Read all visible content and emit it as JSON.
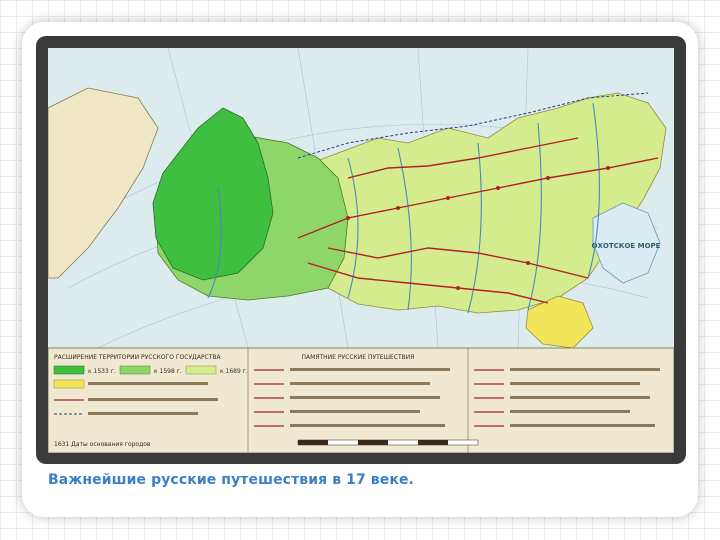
{
  "slide": {
    "caption": "Важнейшие русские путешествия в 17 веке."
  },
  "map": {
    "sea_labels": [
      "ОХОТСКОЕ МОРЕ"
    ],
    "legend": {
      "left_title": "РАСШИРЕНИЕ ТЕРРИТОРИИ РУССКОГО ГОСУДАРСТВА",
      "territory_1533": "к 1533 г.",
      "territory_1598": "к 1598 г.",
      "territory_1689": "к 1689 г.",
      "center_title": "ПАМЯТНИЕ РУССКИЕ ПУТЕШЕСТВИЯ",
      "founding_year_note": "1631 Даты основания городов"
    },
    "colors": {
      "territory_1533": "#3fbf3f",
      "territory_1598": "#8fd66a",
      "territory_1689": "#d4ec8e",
      "chinese_ceded": "#f1e65a",
      "water": "#d9ecf2",
      "route": "#b0202a"
    }
  }
}
